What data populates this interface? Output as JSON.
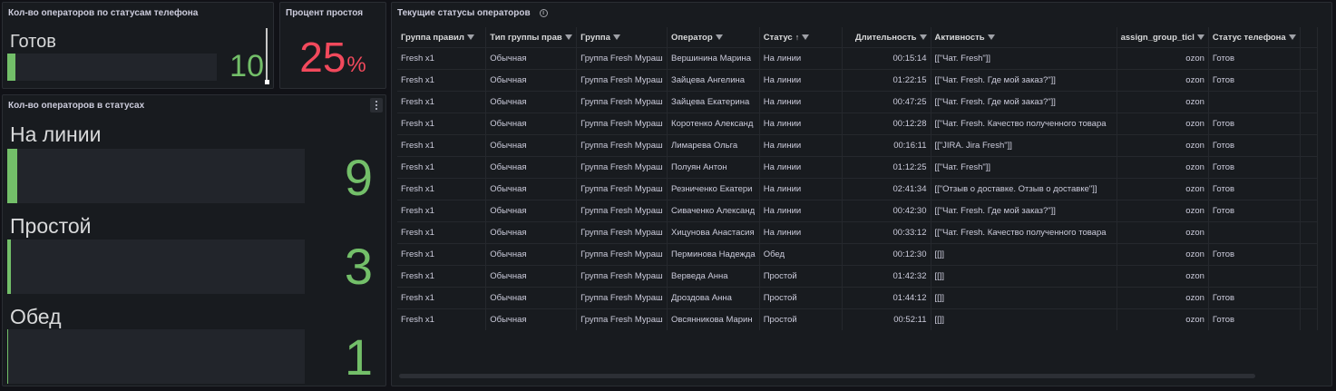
{
  "colors": {
    "accent_green": "#73bf69",
    "alert_red": "#f2495c",
    "panel_bg": "#181b1f",
    "page_bg": "#111217"
  },
  "phone_panel": {
    "title": "Кол-во операторов по статусам телефона",
    "label": "Готов",
    "value": "10",
    "fill_fraction": 0.04
  },
  "idle_panel": {
    "title": "Процент простоя",
    "value": "25",
    "unit": "%"
  },
  "status_panel": {
    "title": "Кол-во операторов в статусах",
    "menu_icon": "kebab-menu-icon",
    "gauges": [
      {
        "label": "На линии",
        "value": "9",
        "fill_fraction": 0.035
      },
      {
        "label": "Простой",
        "value": "3",
        "fill_fraction": 0.012
      },
      {
        "label": "Обед",
        "value": "1",
        "fill_fraction": 0.004
      }
    ]
  },
  "table_panel": {
    "title": "Текущие статусы операторов",
    "info_icon": "info-icon",
    "columns": [
      {
        "label": "Группа правил",
        "filter_icon": "filter-icon"
      },
      {
        "label": "Тип группы прав",
        "filter_icon": "filter-icon"
      },
      {
        "label": "Группа",
        "filter_icon": "filter-icon"
      },
      {
        "label": "Оператор",
        "filter_icon": "filter-icon"
      },
      {
        "label": "Статус",
        "sort": "↑",
        "sort_icon": "sort-ascending-icon",
        "filter_icon": "filter-icon"
      },
      {
        "label": "Длительность",
        "filter_icon": "filter-icon"
      },
      {
        "label": "Активность",
        "filter_icon": "filter-icon"
      },
      {
        "label": "assign_group_ticl",
        "filter_icon": "filter-icon"
      },
      {
        "label": "Статус телефона",
        "filter_icon": "filter-icon"
      }
    ],
    "rows": [
      [
        "Fresh x1",
        "Обычная",
        "Группа Fresh Мураш",
        "Вершинина Марина",
        "На линии",
        "00:15:14",
        "[[\"Чат. Fresh\"]]",
        "ozon",
        "Готов"
      ],
      [
        "Fresh x1",
        "Обычная",
        "Группа Fresh Мураш",
        "Зайцева Ангелина",
        "На линии",
        "01:22:15",
        "[[\"Чат. Fresh. Где мой заказ?\"]]",
        "ozon",
        "Готов"
      ],
      [
        "Fresh x1",
        "Обычная",
        "Группа Fresh Мураш",
        "Зайцева Екатерина",
        "На линии",
        "00:47:25",
        "[[\"Чат. Fresh. Где мой заказ?\"]]",
        "ozon",
        ""
      ],
      [
        "Fresh x1",
        "Обычная",
        "Группа Fresh Мураш",
        "Коротенко Александ",
        "На линии",
        "00:12:28",
        "[[\"Чат. Fresh. Качество полученного товара",
        "ozon",
        "Готов"
      ],
      [
        "Fresh x1",
        "Обычная",
        "Группа Fresh Мураш",
        "Лимарева Ольга",
        "На линии",
        "00:16:11",
        "[[\"JIRA. Jira Fresh\"]]",
        "ozon",
        "Готов"
      ],
      [
        "Fresh x1",
        "Обычная",
        "Группа Fresh Мураш",
        "Полуян Антон",
        "На линии",
        "01:12:25",
        "[[\"Чат. Fresh\"]]",
        "ozon",
        "Готов"
      ],
      [
        "Fresh x1",
        "Обычная",
        "Группа Fresh Мураш",
        "Резниченко Екатери",
        "На линии",
        "02:41:34",
        "[[\"Отзыв о доставке. Отзыв о доставке\"]]",
        "ozon",
        "Готов"
      ],
      [
        "Fresh x1",
        "Обычная",
        "Группа Fresh Мураш",
        "Сиваченко Александ",
        "На линии",
        "00:42:30",
        "[[\"Чат. Fresh. Где мой заказ?\"]]",
        "ozon",
        "Готов"
      ],
      [
        "Fresh x1",
        "Обычная",
        "Группа Fresh Мураш",
        "Хицунова Анастасия",
        "На линии",
        "00:33:12",
        "[[\"Чат. Fresh. Качество полученного товара",
        "ozon",
        ""
      ],
      [
        "Fresh x1",
        "Обычная",
        "Группа Fresh Мураш",
        "Перминова Надежда",
        "Обед",
        "00:12:30",
        "[[]]",
        "ozon",
        "Готов"
      ],
      [
        "Fresh x1",
        "Обычная",
        "Группа Fresh Мураш",
        "Верведа Анна",
        "Простой",
        "01:42:32",
        "[[]]",
        "ozon",
        ""
      ],
      [
        "Fresh x1",
        "Обычная",
        "Группа Fresh Мураш",
        "Дроздова Анна",
        "Простой",
        "01:44:12",
        "[[]]",
        "ozon",
        "Готов"
      ],
      [
        "Fresh x1",
        "Обычная",
        "Группа Fresh Мураш",
        "Овсянникова Марин",
        "Простой",
        "00:52:11",
        "[[]]",
        "ozon",
        "Готов"
      ]
    ]
  }
}
